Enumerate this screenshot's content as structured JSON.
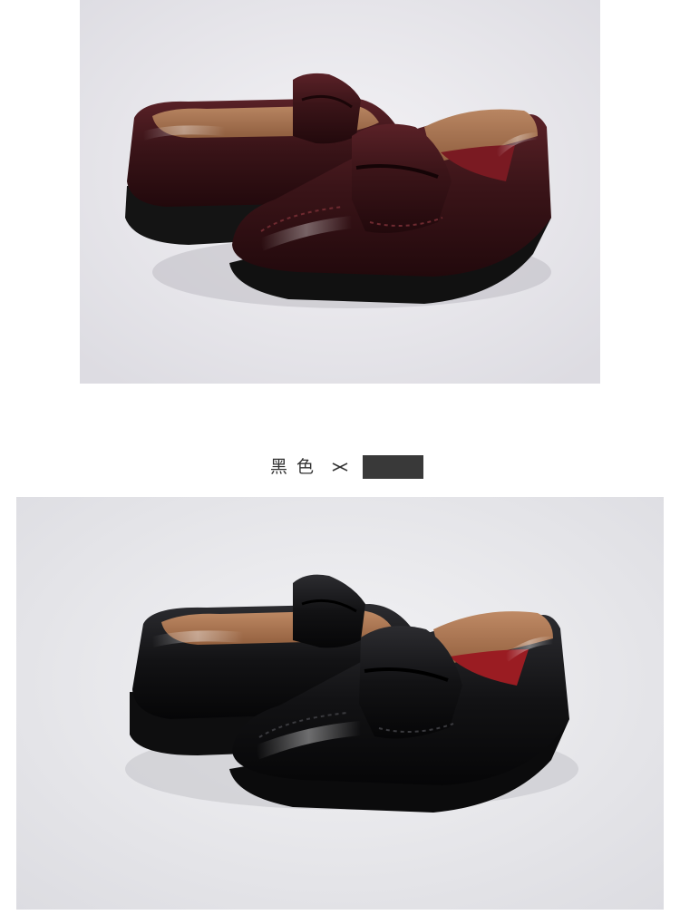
{
  "products": [
    {
      "name": "penny-loafer-brown-photo",
      "leather_color": "#3a1418",
      "background_color": "#e8e7ec"
    },
    {
      "name": "penny-loafer-black-photo",
      "leather_color": "#101012",
      "background_color": "#e6e6ea"
    }
  ],
  "color_option": {
    "label": "黑色",
    "arrow_icon": "arrow-right-icon",
    "swatch_color": "#393939"
  }
}
